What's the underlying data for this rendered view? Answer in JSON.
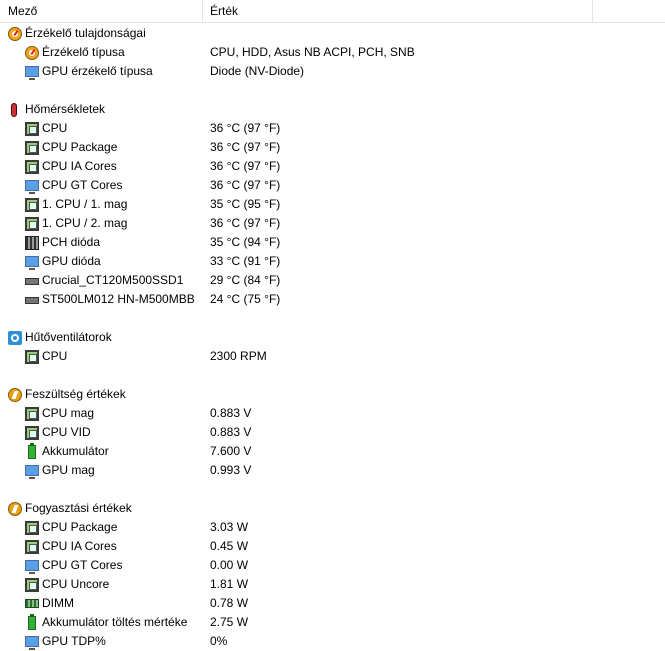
{
  "header": {
    "col_field": "Mező",
    "col_value": "Érték"
  },
  "groups": [
    {
      "title": "Érzékelő tulajdonságai",
      "icon": "gauge-icon",
      "items": [
        {
          "label": "Érzékelő típusa",
          "value": "CPU, HDD, Asus NB ACPI, PCH, SNB",
          "icon": "gauge-icon"
        },
        {
          "label": "GPU érzékelő típusa",
          "value": "Diode  (NV-Diode)",
          "icon": "monitor-icon"
        }
      ]
    },
    {
      "title": "Hőmérsékletek",
      "icon": "thermometer-icon",
      "items": [
        {
          "label": "CPU",
          "value": "36 °C  (97 °F)",
          "icon": "chip-icon"
        },
        {
          "label": "CPU Package",
          "value": "36 °C  (97 °F)",
          "icon": "chip-icon"
        },
        {
          "label": "CPU IA Cores",
          "value": "36 °C  (97 °F)",
          "icon": "chip-icon"
        },
        {
          "label": "CPU GT Cores",
          "value": "36 °C  (97 °F)",
          "icon": "monitor-icon"
        },
        {
          "label": "1. CPU / 1. mag",
          "value": "35 °C  (95 °F)",
          "icon": "chip-icon"
        },
        {
          "label": "1. CPU / 2. mag",
          "value": "36 °C  (97 °F)",
          "icon": "chip-icon"
        },
        {
          "label": "PCH dióda",
          "value": "35 °C  (94 °F)",
          "icon": "pch-icon"
        },
        {
          "label": "GPU dióda",
          "value": "33 °C  (91 °F)",
          "icon": "monitor-icon"
        },
        {
          "label": "Crucial_CT120M500SSD1",
          "value": "29 °C  (84 °F)",
          "icon": "hdd-icon"
        },
        {
          "label": "ST500LM012 HN-M500MBB",
          "value": "24 °C  (75 °F)",
          "icon": "hdd-icon"
        }
      ]
    },
    {
      "title": "Hűtőventilátorok",
      "icon": "fan-icon",
      "items": [
        {
          "label": "CPU",
          "value": "2300 RPM",
          "icon": "chip-icon"
        }
      ]
    },
    {
      "title": "Feszültség értékek",
      "icon": "bolt-icon",
      "items": [
        {
          "label": "CPU mag",
          "value": "0.883 V",
          "icon": "chip-icon"
        },
        {
          "label": "CPU VID",
          "value": "0.883 V",
          "icon": "chip-icon"
        },
        {
          "label": "Akkumulátor",
          "value": "7.600 V",
          "icon": "battery-icon"
        },
        {
          "label": "GPU mag",
          "value": "0.993 V",
          "icon": "monitor-icon"
        }
      ]
    },
    {
      "title": "Fogyasztási értékek",
      "icon": "bolt-icon",
      "items": [
        {
          "label": "CPU Package",
          "value": "3.03 W",
          "icon": "chip-icon"
        },
        {
          "label": "CPU IA Cores",
          "value": "0.45 W",
          "icon": "chip-icon"
        },
        {
          "label": "CPU GT Cores",
          "value": "0.00 W",
          "icon": "monitor-icon"
        },
        {
          "label": "CPU Uncore",
          "value": "1.81 W",
          "icon": "chip-icon"
        },
        {
          "label": "DIMM",
          "value": "0.78 W",
          "icon": "dimm-icon"
        },
        {
          "label": "Akkumulátor töltés mértéke",
          "value": "2.75 W",
          "icon": "battery-icon"
        },
        {
          "label": "GPU TDP%",
          "value": "0%",
          "icon": "monitor-icon"
        }
      ]
    }
  ]
}
